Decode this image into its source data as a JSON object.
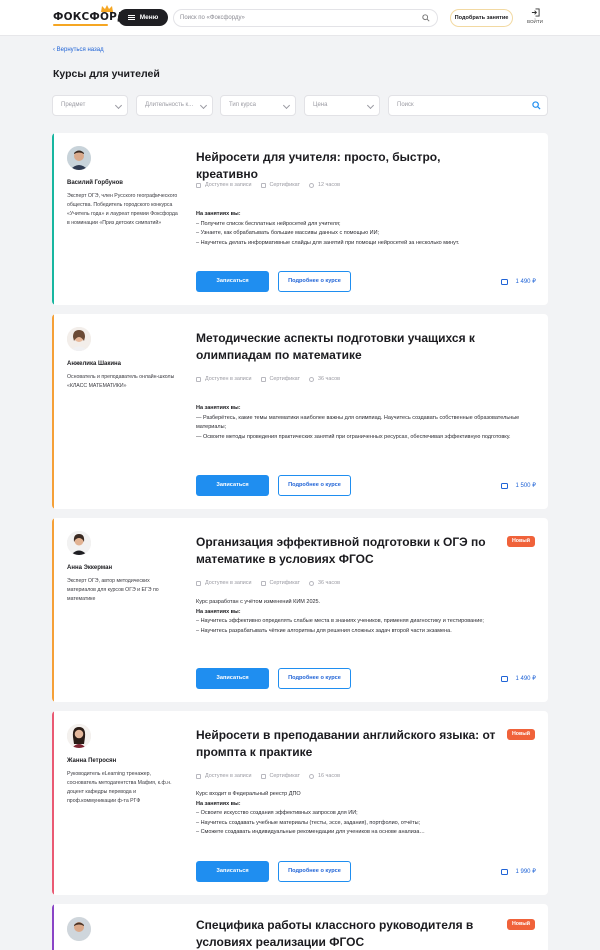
{
  "header": {
    "logo": "ФОКСФОРД",
    "menu_label": "Меню",
    "search_placeholder": "Поиск по «Фоксфорду»",
    "pick_label": "Подобрать занятие",
    "login_label": "ВОЙТИ"
  },
  "breadcrumb": {
    "back_label": "Вернуться назад"
  },
  "page": {
    "title": "Курсы для учителей"
  },
  "filters": {
    "subject": "Предмет",
    "duration": "Длительность к...",
    "type": "Тип курса",
    "price": "Цена",
    "search_placeholder": "Поиск"
  },
  "card_labels": {
    "access": "Доступен в записи",
    "certificate": "Сертификат",
    "enroll": "Записаться",
    "more": "Подробнее о курсе",
    "new_badge": "Новый",
    "results_label": "На занятиях вы:"
  },
  "colors": {
    "accent_blue": "#1f8ef0",
    "badge_new": "#f0623a",
    "card1_bar": "#17b6a0",
    "card2_bar": "#f5a037",
    "card3_bar": "#f5a037",
    "card4_bar": "#ea5a73",
    "card5_bar": "#8a45c6"
  },
  "courses": [
    {
      "author": "Василий Горбунов",
      "bio": "Эксперт ОГЭ, член Русского географического общества. Победитель городского конкурса «Учитель года» и лауреат премии Фоксфорда в номинации «Приз детских симпатий»",
      "title": "Нейросети для учителя: просто, быстро, креативно",
      "hours": "12 часов",
      "intro": "",
      "bullets": [
        "– Получите список бесплатных нейросетей для учителя;",
        "– Узнаете, как обрабатывать большие массивы данных с помощью ИИ;",
        "– Научитесь делать информативные слайды для занятий при помощи нейросетей за несколько минут."
      ],
      "price": "1 490 ₽"
    },
    {
      "author": "Анжелика Шакина",
      "bio": "Основатель и преподаватель онлайн-школы «КЛАСС МАТЕМАТИКИ»",
      "title": "Методические аспекты подготовки учащихся к олимпиадам по математике",
      "hours": "36 часов",
      "intro": "",
      "bullets": [
        "— Разберётесь, какие темы математики наиболее важны для олимпиад. Научитесь создавать собственные образовательные материалы;",
        "— Освоите методы проведения практических занятий при ограниченных ресурсах, обеспечивая эффективную подготовку."
      ],
      "price": "1 500 ₽"
    },
    {
      "author": "Анна Эккерман",
      "bio": "Эксперт ОГЭ, автор методических материалов для курсов ОГЭ и ЕГЭ по математике",
      "title": "Организация эффективной подготовки к ОГЭ по математике в условиях ФГОС",
      "hours": "36 часов",
      "intro": "Курс разработан с учётом изменений КИМ 2025.",
      "bullets": [
        "– Научитесь эффективно определять слабые места в знаниях учеников, применяя диагностику и тестирование;",
        "– Научитесь разрабатывать чёткие алгоритмы для решения сложных задач второй части экзамена."
      ],
      "price": "1 490 ₽"
    },
    {
      "author": "Жанна Петросян",
      "bio": "Руководитель eLearning тренажер, соснователь методагентства Мафия, к.ф.н. доцент кафедры перевода и проф.коммуникации ф-та РГФ",
      "title": "Нейросети в преподавании английского языка: от промпта к практике",
      "hours": "16 часов",
      "intro": "Курс входит в Федеральный реестр ДПО",
      "bullets": [
        "– Освоите искусство создания эффективных запросов для ИИ;",
        "– Научитесь создавать учебные материалы (тесты, эссе, задания), портфолио, отчёты;",
        "– Сможете создавать индивидуальные рекомендации для учеников на основе анализа…"
      ],
      "price": "1 990 ₽"
    },
    {
      "title": "Специфика работы классного руководителя в условиях реализации ФГОС"
    }
  ]
}
